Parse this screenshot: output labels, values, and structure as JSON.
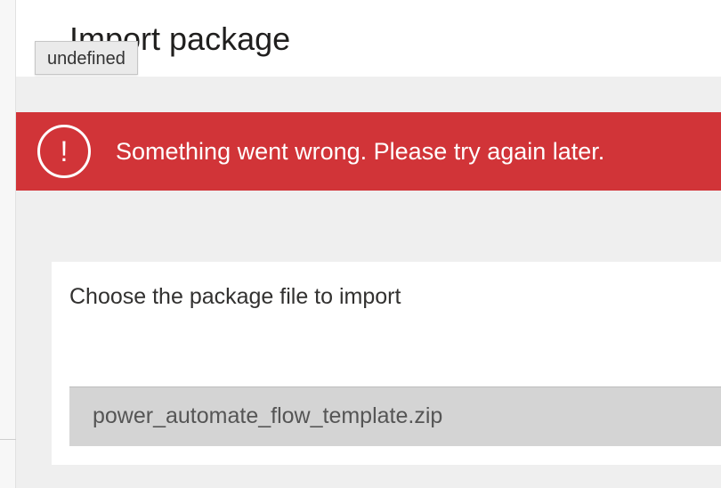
{
  "header": {
    "title": "Import package",
    "tooltip": "undefined"
  },
  "error_banner": {
    "icon_glyph": "!",
    "icon_name": "error-circle-icon",
    "message": "Something went wrong. Please try again later.",
    "color": "#d13438"
  },
  "import_card": {
    "label": "Choose the package file to import",
    "file_name": "power_automate_flow_template.zip"
  }
}
